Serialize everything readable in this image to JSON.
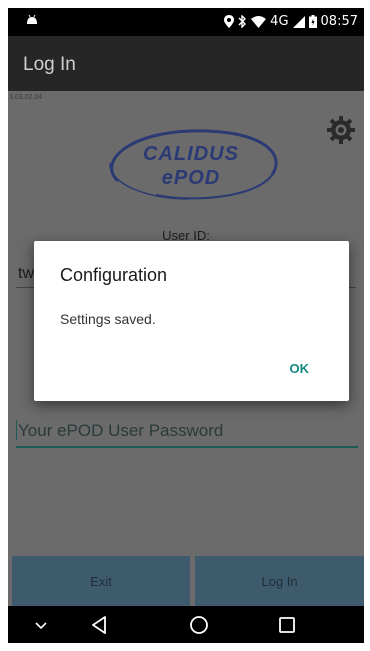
{
  "status_bar": {
    "network": "4G",
    "time": "08:57"
  },
  "app_bar": {
    "title": "Log In"
  },
  "login": {
    "version": "3.03.02.04",
    "logo_line1": "CALIDUS",
    "logo_line2": "ePOD",
    "userid_label": "User ID:",
    "userid_value": "tw",
    "password_placeholder": "Your ePOD User Password",
    "exit_label": "Exit",
    "login_label": "Log In"
  },
  "dialog": {
    "title": "Configuration",
    "message": "Settings saved.",
    "ok_label": "OK"
  },
  "icons": {
    "settings": "gear-icon",
    "back": "back-triangle-icon",
    "home": "home-circle-icon",
    "recents": "recents-square-icon",
    "collapse": "chevron-down-icon"
  },
  "colors": {
    "accent": "#138a80",
    "button": "#3e5b6e",
    "background": "#6b6b6b",
    "app_bar": "#262626"
  }
}
